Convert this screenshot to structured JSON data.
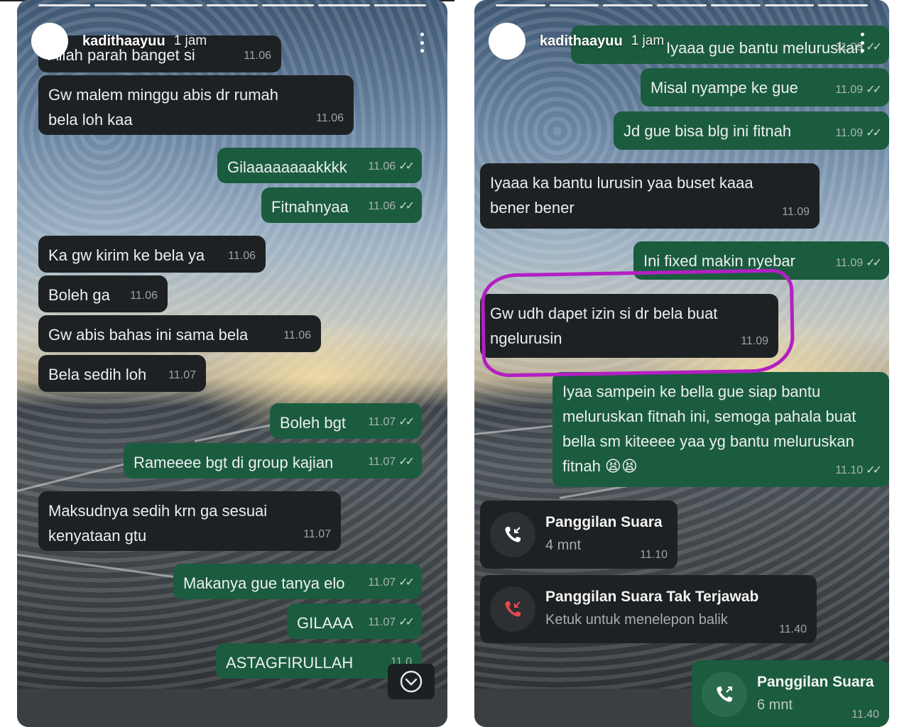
{
  "left": {
    "header": {
      "username": "kadithaayuu",
      "time_ago": "1 jam"
    },
    "messages": [
      {
        "dir": "in",
        "text": "Allah parah banget si",
        "time": "11.06"
      },
      {
        "dir": "in",
        "text": "Gw malem minggu abis dr rumah bela loh kaa",
        "time": "11.06"
      },
      {
        "dir": "out",
        "text": "Gilaaaaaaaakkkk",
        "time": "11.06"
      },
      {
        "dir": "out",
        "text": "Fitnahnyaa",
        "time": "11.06"
      },
      {
        "dir": "in",
        "text": "Ka gw kirim ke bela ya",
        "time": "11.06"
      },
      {
        "dir": "in",
        "text": "Boleh ga",
        "time": "11.06"
      },
      {
        "dir": "in",
        "text": "Gw abis bahas ini sama bela",
        "time": "11.06"
      },
      {
        "dir": "in",
        "text": "Bela sedih loh",
        "time": "11.07"
      },
      {
        "dir": "out",
        "text": "Boleh bgt",
        "time": "11.07"
      },
      {
        "dir": "out",
        "text": "Rameeee bgt di group kajian",
        "time": "11.07"
      },
      {
        "dir": "in",
        "text": "Maksudnya sedih krn ga sesuai kenyataan gtu",
        "time": "11.07"
      },
      {
        "dir": "out",
        "text": "Makanya gue tanya elo",
        "time": "11.07"
      },
      {
        "dir": "out",
        "text": "GILAAA",
        "time": "11.07"
      },
      {
        "dir": "out",
        "text": "ASTAGFIRULLAH",
        "time": "11.0"
      }
    ]
  },
  "right": {
    "header": {
      "username": "kadithaayuu",
      "time_ago": "1 jam"
    },
    "messages": [
      {
        "dir": "out",
        "text": "Iyaaa gue bantu meluruskan",
        "time": "11.09"
      },
      {
        "dir": "out",
        "text": "Misal nyampe ke gue",
        "time": "11.09"
      },
      {
        "dir": "out",
        "text": "Jd gue bisa blg ini fitnah",
        "time": "11.09"
      },
      {
        "dir": "in",
        "text": "Iyaaa ka bantu lurusin yaa buset kaaa bener bener",
        "time": "11.09"
      },
      {
        "dir": "out",
        "text": "Ini fixed makin nyebar",
        "time": "11.09"
      },
      {
        "dir": "in",
        "text": "Gw udh dapet izin si dr bela buat ngelurusin",
        "time": "11.09"
      },
      {
        "dir": "out",
        "text": "Iyaa sampein ke bella gue siap bantu meluruskan fitnah ini, semoga pahala buat bella sm kiteeee yaa yg bantu meluruskan fitnah 😫😫",
        "time": "11.10"
      }
    ],
    "calls": [
      {
        "dir": "in",
        "title": "Panggilan Suara",
        "sub": "4 mnt",
        "time": "11.10",
        "type": "incoming-call-icon"
      },
      {
        "dir": "in",
        "title": "Panggilan Suara Tak Terjawab",
        "sub": "Ketuk untuk menelepon balik",
        "time": "11.40",
        "type": "missed-call-icon"
      },
      {
        "dir": "out",
        "title": "Panggilan Suara",
        "sub": "6 mnt",
        "time": "11.40",
        "type": "outgoing-call-icon"
      }
    ]
  },
  "colors": {
    "incoming_bubble": "#1e2123",
    "outgoing_bubble": "#1b5c3e",
    "highlight": "#b31fc4",
    "missed_call": "#e5484d"
  }
}
